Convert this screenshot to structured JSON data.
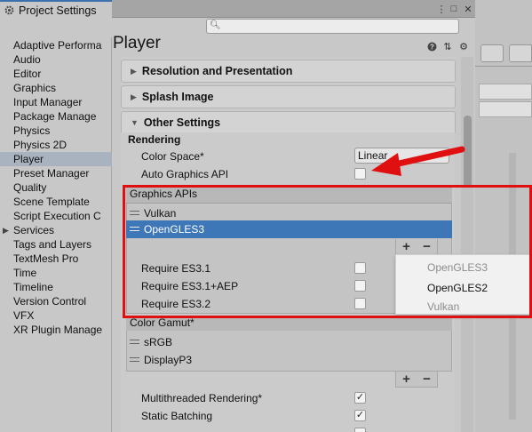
{
  "window": {
    "tab_title": "Project Settings",
    "search_placeholder": ""
  },
  "sidebar": {
    "items": [
      {
        "label": "Adaptive Performa"
      },
      {
        "label": "Audio"
      },
      {
        "label": "Editor"
      },
      {
        "label": "Graphics"
      },
      {
        "label": "Input Manager"
      },
      {
        "label": "Package Manage"
      },
      {
        "label": "Physics"
      },
      {
        "label": "Physics 2D"
      },
      {
        "label": "Player",
        "selected": true
      },
      {
        "label": "Preset Manager"
      },
      {
        "label": "Quality"
      },
      {
        "label": "Scene Template"
      },
      {
        "label": "Script Execution C"
      },
      {
        "label": "Services",
        "expandable": true
      },
      {
        "label": "Tags and Layers"
      },
      {
        "label": "TextMesh Pro"
      },
      {
        "label": "Time"
      },
      {
        "label": "Timeline"
      },
      {
        "label": "Version Control"
      },
      {
        "label": "VFX"
      },
      {
        "label": "XR Plugin Manage"
      }
    ]
  },
  "header": {
    "title": "Player",
    "icons": [
      "help-icon",
      "preset-icon",
      "gear-icon"
    ]
  },
  "sections": {
    "resolution": "Resolution and Presentation",
    "splash": "Splash Image",
    "other": "Other Settings"
  },
  "rendering": {
    "heading": "Rendering",
    "color_space_label": "Color Space*",
    "color_space_value": "Linear",
    "auto_graphics_label": "Auto Graphics API",
    "auto_graphics_checked": false
  },
  "graphics_apis": {
    "heading": "Graphics APIs",
    "items": [
      "Vulkan",
      "OpenGLES3"
    ],
    "selected": "OpenGLES3",
    "add": "+",
    "remove": "−"
  },
  "requires": [
    {
      "label": "Require ES3.1",
      "checked": false
    },
    {
      "label": "Require ES3.1+AEP",
      "checked": false
    },
    {
      "label": "Require ES3.2",
      "checked": false
    }
  ],
  "popup": {
    "items": [
      {
        "label": "OpenGLES3",
        "enabled": false
      },
      {
        "label": "OpenGLES2",
        "enabled": true
      },
      {
        "label": "Vulkan",
        "enabled": false
      }
    ]
  },
  "color_gamut": {
    "heading": "Color Gamut*",
    "items": [
      "sRGB",
      "DisplayP3"
    ],
    "add": "+",
    "remove": "−"
  },
  "options": [
    {
      "label": "Multithreaded Rendering*",
      "checked": true
    },
    {
      "label": "Static Batching",
      "checked": true
    }
  ],
  "colors": {
    "selection": "#3d77b8",
    "annotation": "#e01010"
  }
}
